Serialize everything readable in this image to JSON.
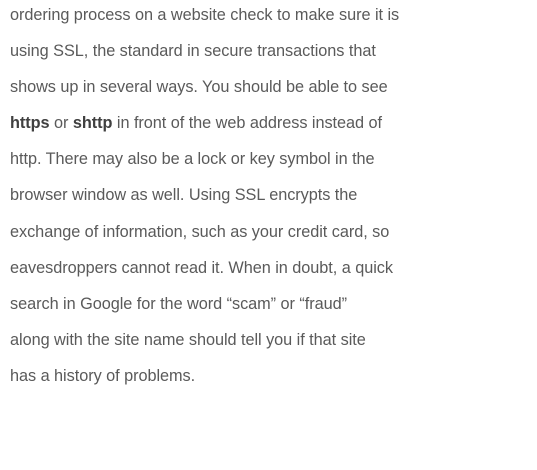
{
  "article": {
    "lines": [
      "ordering process on a website check to make sure it is",
      "using SSL, the standard in secure transactions that",
      "shows up in several ways. You should be able to see",
      {
        "bold1": "https",
        "t1": " or ",
        "bold2": "shttp",
        "t2": " in front of the web address instead of"
      },
      "http. There may also be a lock or key symbol in the",
      "browser window as well. Using SSL encrypts the",
      "exchange of information, such as your credit card, so",
      "eavesdroppers cannot read it. When in doubt, a quick",
      "search in Google for the word “scam” or “fraud”",
      "along with the site name should tell you if that site",
      "has a history of problems."
    ]
  }
}
